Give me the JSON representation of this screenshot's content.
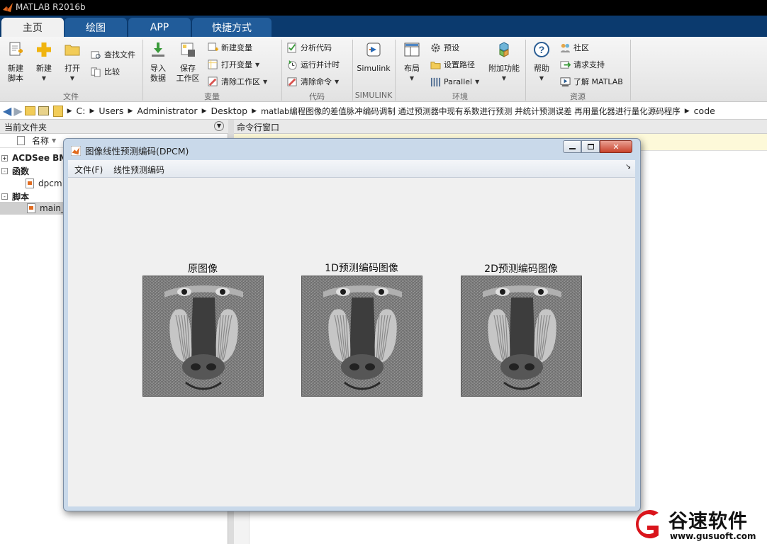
{
  "window": {
    "title": "MATLAB R2016b"
  },
  "tabs": [
    {
      "label": "主页",
      "active": true
    },
    {
      "label": "绘图",
      "active": false
    },
    {
      "label": "APP",
      "active": false
    },
    {
      "label": "快捷方式",
      "active": false
    }
  ],
  "ribbon": {
    "file": {
      "group_label": "文件",
      "new_script": "新建\n脚本",
      "new": "新建",
      "open": "打开",
      "find_files": "查找文件",
      "compare": "比较"
    },
    "variable": {
      "group_label": "变量",
      "import_data": "导入\n数据",
      "save_workspace": "保存\n工作区",
      "new_variable": "新建变量",
      "open_variable": "打开变量",
      "clear_workspace": "清除工作区"
    },
    "code": {
      "group_label": "代码",
      "analyze_code": "分析代码",
      "run_and_time": "运行并计时",
      "clear_commands": "清除命令"
    },
    "simulink": {
      "group_label": "SIMULINK",
      "simulink": "Simulink"
    },
    "environment": {
      "group_label": "环境",
      "layout": "布局",
      "preferences": "预设",
      "set_path": "设置路径",
      "parallel": "Parallel",
      "addons": "附加功能"
    },
    "resources": {
      "group_label": "资源",
      "help": "帮助",
      "community": "社区",
      "request_support": "请求支持",
      "learn_matlab": "了解 MATLAB"
    }
  },
  "address": {
    "segments": [
      "C:",
      "Users",
      "Administrator",
      "Desktop",
      "matlab编程图像的差值脉冲编码调制 通过预测器中现有系数进行预测 并统计预测误差 再用量化器进行量化源码程序",
      "code"
    ]
  },
  "current_folder": {
    "title": "当前文件夹",
    "column_name": "名称",
    "items": [
      {
        "label": "ACDSee BM",
        "kind": "group",
        "sign": "+"
      },
      {
        "label": "函数",
        "kind": "group",
        "sign": "-"
      },
      {
        "label": "dpcm",
        "kind": "file"
      },
      {
        "label": "脚本",
        "kind": "group",
        "sign": "-"
      },
      {
        "label": "main_",
        "kind": "file",
        "selected": true
      }
    ]
  },
  "command_window": {
    "title": "命令行窗口"
  },
  "figure": {
    "title": "图像线性预测编码(DPCM)",
    "menu": [
      "文件(F)",
      "线性预测编码"
    ],
    "axes": [
      {
        "title": "原图像",
        "image": "mandrill-grayscale"
      },
      {
        "title": "1D预测编码图像",
        "image": "mandrill-grayscale"
      },
      {
        "title": "2D预测编码图像",
        "image": "mandrill-grayscale"
      }
    ]
  },
  "watermark": {
    "name": "谷速软件",
    "url": "www.gusuoft.com"
  },
  "colors": {
    "titlebar": "#000000",
    "tabrow": "#0b3a6e",
    "tab": "#215c9a",
    "ribbon": "#eeeeee",
    "figure_frame": "#c9d9ea",
    "watermark_red": "#d9141b"
  }
}
